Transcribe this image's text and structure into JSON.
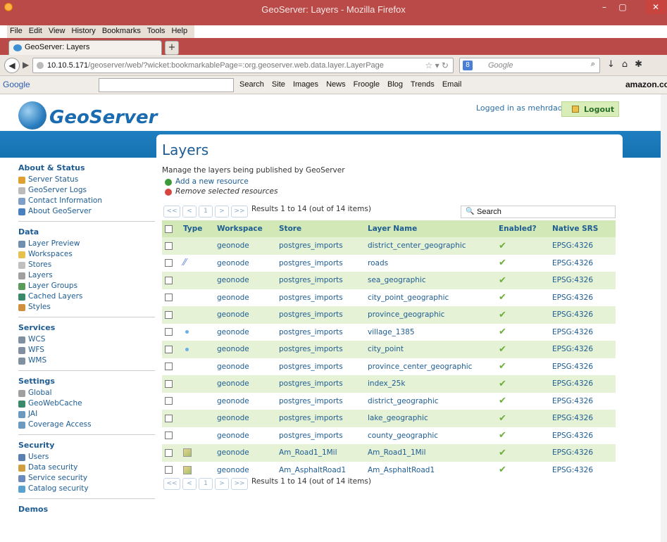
{
  "window": {
    "title": "GeoServer: Layers - Mozilla Firefox",
    "min": "–",
    "max": "▢",
    "close": "✕"
  },
  "menu": [
    {
      "label": "File"
    },
    {
      "label": "Edit"
    },
    {
      "label": "View"
    },
    {
      "label": "History"
    },
    {
      "label": "Bookmarks"
    },
    {
      "label": "Tools"
    },
    {
      "label": "Help"
    }
  ],
  "tab": {
    "title": "GeoServer: Layers",
    "new_tab": "+"
  },
  "nav": {
    "url_host": "10.10.5.171",
    "url_path": "/geoserver/web/?wicket:bookmarkablePage=:org.geoserver.web.data.layer.LayerPage",
    "search_placeholder": "Google"
  },
  "google_toolbar": {
    "logo": "Google",
    "items": [
      "Search",
      "Site",
      "Images",
      "News",
      "Froogle",
      "Blog",
      "Trends",
      "Email"
    ],
    "amazon": "amazon.co"
  },
  "header": {
    "logo_text": "GeoServer",
    "logged_in": "Logged in as mehrdad.",
    "logout": "Logout"
  },
  "sidebar": {
    "sections": [
      {
        "title": "About & Status",
        "items": [
          {
            "label": "Server Status",
            "icon": "server-status-icon",
            "color": "#e0a030"
          },
          {
            "label": "GeoServer Logs",
            "icon": "log-icon",
            "color": "#bbbbbb"
          },
          {
            "label": "Contact Information",
            "icon": "contact-icon",
            "color": "#7ea0c8"
          },
          {
            "label": "About GeoServer",
            "icon": "info-icon",
            "color": "#4a80c0"
          }
        ]
      },
      {
        "title": "Data",
        "items": [
          {
            "label": "Layer Preview",
            "icon": "layer-preview-icon",
            "color": "#6e8fb0"
          },
          {
            "label": "Workspaces",
            "icon": "folder-icon",
            "color": "#e8c050"
          },
          {
            "label": "Stores",
            "icon": "store-icon",
            "color": "#c0c0c0"
          },
          {
            "label": "Layers",
            "icon": "layers-icon",
            "color": "#a0a0a0"
          },
          {
            "label": "Layer Groups",
            "icon": "layer-groups-icon",
            "color": "#5a9a5a"
          },
          {
            "label": "Cached Layers",
            "icon": "globe-icon",
            "color": "#3a8a6a"
          },
          {
            "label": "Styles",
            "icon": "styles-icon",
            "color": "#d09040"
          }
        ]
      },
      {
        "title": "Services",
        "items": [
          {
            "label": "WCS",
            "icon": "wcs-icon",
            "color": "#8090a0"
          },
          {
            "label": "WFS",
            "icon": "wfs-icon",
            "color": "#8090a0"
          },
          {
            "label": "WMS",
            "icon": "wms-icon",
            "color": "#8090a0"
          }
        ]
      },
      {
        "title": "Settings",
        "items": [
          {
            "label": "Global",
            "icon": "global-icon",
            "color": "#a0a0a0"
          },
          {
            "label": "GeoWebCache",
            "icon": "geowebcache-icon",
            "color": "#3a8a6a"
          },
          {
            "label": "JAI",
            "icon": "jai-icon",
            "color": "#6a9ac0"
          },
          {
            "label": "Coverage Access",
            "icon": "coverage-icon",
            "color": "#6a9ac0"
          }
        ]
      },
      {
        "title": "Security",
        "items": [
          {
            "label": "Users",
            "icon": "users-icon",
            "color": "#5a80b0"
          },
          {
            "label": "Data security",
            "icon": "data-security-icon",
            "color": "#d0a040"
          },
          {
            "label": "Service security",
            "icon": "service-security-icon",
            "color": "#6a8ac0"
          },
          {
            "label": "Catalog security",
            "icon": "catalog-security-icon",
            "color": "#5aa0d0"
          }
        ]
      },
      {
        "title": "Demos",
        "items": []
      }
    ]
  },
  "main": {
    "title": "Layers",
    "description": "Manage the layers being published by GeoServer",
    "add_resource": "Add a new resource",
    "remove_resources": "Remove selected resources",
    "pager": {
      "first": "<<",
      "prev": "<",
      "page": "1",
      "next": ">",
      "last": ">>",
      "results": "Results 1 to 14 (out of 14 items)"
    },
    "search_label": "Search",
    "columns": [
      "Type",
      "Workspace",
      "Store",
      "Layer Name",
      "Enabled?",
      "Native SRS"
    ],
    "rows": [
      {
        "type": "polygon",
        "workspace": "geonode",
        "store": "postgres_imports",
        "layer": "district_center_geographic",
        "enabled": "✔",
        "srs": "EPSG:4326"
      },
      {
        "type": "line",
        "workspace": "geonode",
        "store": "postgres_imports",
        "layer": "roads",
        "enabled": "✔",
        "srs": "EPSG:4326"
      },
      {
        "type": "polygon",
        "workspace": "geonode",
        "store": "postgres_imports",
        "layer": "sea_geographic",
        "enabled": "✔",
        "srs": "EPSG:4326"
      },
      {
        "type": "polygon",
        "workspace": "geonode",
        "store": "postgres_imports",
        "layer": "city_point_geographic",
        "enabled": "✔",
        "srs": "EPSG:4326"
      },
      {
        "type": "polygon",
        "workspace": "geonode",
        "store": "postgres_imports",
        "layer": "province_geographic",
        "enabled": "✔",
        "srs": "EPSG:4326"
      },
      {
        "type": "point",
        "workspace": "geonode",
        "store": "postgres_imports",
        "layer": "village_1385",
        "enabled": "✔",
        "srs": "EPSG:4326"
      },
      {
        "type": "point",
        "workspace": "geonode",
        "store": "postgres_imports",
        "layer": "city_point",
        "enabled": "✔",
        "srs": "EPSG:4326"
      },
      {
        "type": "polygon",
        "workspace": "geonode",
        "store": "postgres_imports",
        "layer": "province_center_geographic",
        "enabled": "✔",
        "srs": "EPSG:4326"
      },
      {
        "type": "polygon",
        "workspace": "geonode",
        "store": "postgres_imports",
        "layer": "index_25k",
        "enabled": "✔",
        "srs": "EPSG:4326"
      },
      {
        "type": "polygon",
        "workspace": "geonode",
        "store": "postgres_imports",
        "layer": "district_geographic",
        "enabled": "✔",
        "srs": "EPSG:4326"
      },
      {
        "type": "polygon",
        "workspace": "geonode",
        "store": "postgres_imports",
        "layer": "lake_geographic",
        "enabled": "✔",
        "srs": "EPSG:4326"
      },
      {
        "type": "polygon",
        "workspace": "geonode",
        "store": "postgres_imports",
        "layer": "county_geographic",
        "enabled": "✔",
        "srs": "EPSG:4326"
      },
      {
        "type": "raster",
        "workspace": "geonode",
        "store": "Am_Road1_1Mil",
        "layer": "Am_Road1_1Mil",
        "enabled": "✔",
        "srs": "EPSG:4326"
      },
      {
        "type": "raster",
        "workspace": "geonode",
        "store": "Am_AsphaltRoad1",
        "layer": "Am_AsphaltRoad1",
        "enabled": "✔",
        "srs": "EPSG:4326"
      }
    ]
  },
  "colors": {
    "accent": "#1d5c93",
    "header_band": "#1f7ec0",
    "row_alt": "#e6f2d6",
    "enabled": "#6cae3c"
  }
}
